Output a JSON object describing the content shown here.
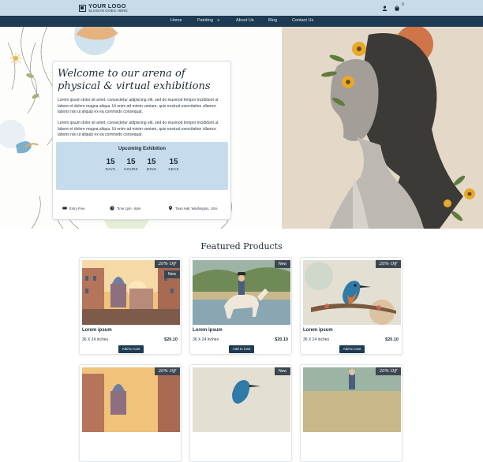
{
  "header": {
    "logo_title": "YOUR LOGO",
    "logo_slogan": "SLOGAN GOES HERE",
    "cart_count": "0"
  },
  "nav": {
    "items": [
      {
        "label": "Home"
      },
      {
        "label": "Painting"
      },
      {
        "label": "About Us"
      },
      {
        "label": "Blog"
      },
      {
        "label": "Contact Us"
      }
    ]
  },
  "hero": {
    "title": "Welcome to our arena of physical & virtual exhibitions",
    "paragraph_1": "Lorem ipsum dolor sit amet, consectetur adipiscing elit, sed do eiusmod tempor incididunt ut labore et dolore magna aliqua. Ut enim ad minim veniam, quis nostrud exercitation ullamco laboris nisi ut aliquip ex ea commodo consequat.",
    "paragraph_2": "Lorem ipsum dolor sit amet, consectetur adipiscing elit, sed do eiusmod tempor incididunt ut labore et dolore magna aliqua. Ut enim ad minim veniam, quis nostrud exercitation ullamco laboris nisi ut aliquip ex ea commodo consequat.",
    "exhibition": {
      "title": "Upcoming Exhibition",
      "countdown": [
        {
          "value": "15",
          "label": "DAYS"
        },
        {
          "value": "15",
          "label": "HOURS"
        },
        {
          "value": "15",
          "label": "MINS"
        },
        {
          "value": "15",
          "label": "SECS"
        }
      ],
      "entry": "Entry Free",
      "time": "Time 1pm - 8pm",
      "location": "Town Hall, Washington, USA."
    }
  },
  "featured": {
    "heading": "Featured Products",
    "products": [
      {
        "name": "Lorem ipsum",
        "size": "36 X 24 inches",
        "price": "$20.10",
        "button": "Add to Cart",
        "badge": "20% Off",
        "badge2": "New",
        "art": "city"
      },
      {
        "name": "Lorem ipsum",
        "size": "36 X 24 inches",
        "price": "$20.10",
        "button": "Add to Cart",
        "badge": "New",
        "art": "horse"
      },
      {
        "name": "Lorem ipsum",
        "size": "36 X 24 inches",
        "price": "$20.10",
        "button": "Add to Cart",
        "badge": "20% Off",
        "art": "bird"
      },
      {
        "badge": "20% Off",
        "art": "city"
      },
      {
        "badge": "New",
        "art": "bird"
      },
      {
        "badge": "20% Off",
        "art": "horse"
      }
    ]
  },
  "colors": {
    "topbar": "#c8dbe9",
    "nav": "#1d3b52",
    "accent_panel": "#c6dbec",
    "button": "#1d3b52"
  }
}
